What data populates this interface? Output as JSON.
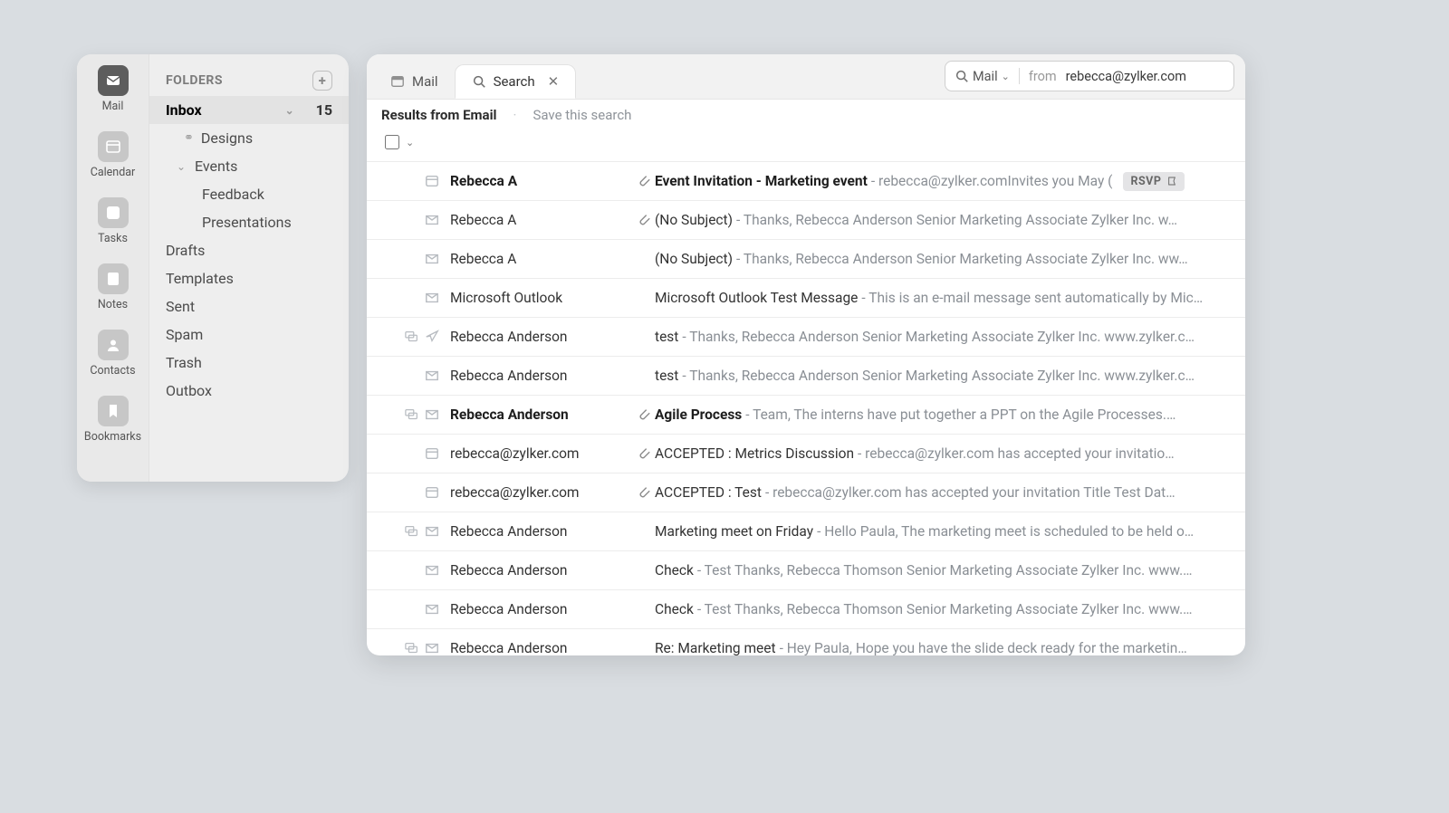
{
  "rail": [
    {
      "label": "Mail",
      "name": "nav-mail",
      "icon": "mail",
      "bg": "#5d5d5d"
    },
    {
      "label": "Calendar",
      "name": "nav-calendar",
      "icon": "calendar",
      "bg": "#c7c7c7"
    },
    {
      "label": "Tasks",
      "name": "nav-tasks",
      "icon": "check",
      "bg": "#c7c7c7"
    },
    {
      "label": "Notes",
      "name": "nav-notes",
      "icon": "note",
      "bg": "#c7c7c7"
    },
    {
      "label": "Contacts",
      "name": "nav-contacts",
      "icon": "user",
      "bg": "#c7c7c7"
    },
    {
      "label": "Bookmarks",
      "name": "nav-bookmarks",
      "icon": "bookmark",
      "bg": "#c7c7c7"
    }
  ],
  "folders": {
    "header": "FOLDERS",
    "inbox": {
      "label": "Inbox",
      "count": "15"
    },
    "designs": "Designs",
    "events": "Events",
    "feedback": "Feedback",
    "presentations": "Presentations",
    "drafts": "Drafts",
    "templates": "Templates",
    "sent": "Sent",
    "spam": "Spam",
    "trash": "Trash",
    "outbox": "Outbox"
  },
  "tabs": {
    "mail": "Mail",
    "search": "Search"
  },
  "search": {
    "scope": "Mail",
    "keyword": "from",
    "value": "rebecca@zylker.com"
  },
  "results": {
    "title": "Results from Email",
    "save": "Save this search"
  },
  "rows": [
    {
      "bold": true,
      "lead": "",
      "kind": "calendar",
      "attach": true,
      "from": "Rebecca A",
      "subject": "Event Invitation - Marketing event",
      "preview": " - rebecca@zylker.comInvites you May (",
      "badge": "RSVP"
    },
    {
      "bold": false,
      "lead": "",
      "kind": "mail",
      "attach": true,
      "from": "Rebecca A",
      "subject": "(No Subject)",
      "preview": " - Thanks, Rebecca Anderson Senior Marketing Associate Zylker Inc. w…"
    },
    {
      "bold": false,
      "lead": "",
      "kind": "mail",
      "attach": false,
      "from": "Rebecca A",
      "subject": "(No Subject)",
      "preview": " - Thanks, Rebecca Anderson Senior Marketing Associate Zylker Inc. ww…"
    },
    {
      "bold": false,
      "lead": "",
      "kind": "mail",
      "attach": false,
      "from": "Microsoft Outlook",
      "subject": "Microsoft Outlook Test Message",
      "preview": " - This is an e-mail message sent automatically by Mic…"
    },
    {
      "bold": false,
      "lead": "thread",
      "kind": "sent",
      "attach": false,
      "from": "Rebecca Anderson",
      "subject": "test",
      "preview": " - Thanks, Rebecca Anderson Senior Marketing Associate Zylker Inc. www.zylker.c…"
    },
    {
      "bold": false,
      "lead": "",
      "kind": "mail",
      "attach": false,
      "from": "Rebecca Anderson",
      "subject": "test",
      "preview": " - Thanks, Rebecca Anderson Senior Marketing Associate Zylker Inc. www.zylker.c…"
    },
    {
      "bold": true,
      "lead": "thread",
      "kind": "mail",
      "attach": true,
      "from": "Rebecca Anderson",
      "subject": "Agile Process",
      "preview": " - Team, The interns have put together a PPT on the Agile Processes.…"
    },
    {
      "bold": false,
      "lead": "",
      "kind": "calendar",
      "attach": true,
      "from": "rebecca@zylker.com",
      "subject": "ACCEPTED : Metrics Discussion",
      "preview": " - rebecca@zylker.com has accepted your invitatio…"
    },
    {
      "bold": false,
      "lead": "",
      "kind": "calendar",
      "attach": true,
      "from": "rebecca@zylker.com",
      "subject": "ACCEPTED : Test",
      "preview": " - rebecca@zylker.com has accepted your invitation Title Test Dat…"
    },
    {
      "bold": false,
      "lead": "thread",
      "kind": "mail",
      "attach": false,
      "from": "Rebecca Anderson",
      "subject": "Marketing meet on Friday",
      "preview": " - Hello Paula, The marketing meet is scheduled to be held o…"
    },
    {
      "bold": false,
      "lead": "",
      "kind": "mail",
      "attach": false,
      "from": "Rebecca Anderson",
      "subject": "Check",
      "preview": " - Test Thanks, Rebecca Thomson Senior Marketing Associate Zylker Inc. www.…"
    },
    {
      "bold": false,
      "lead": "",
      "kind": "mail",
      "attach": false,
      "from": "Rebecca Anderson",
      "subject": "Check",
      "preview": " - Test Thanks, Rebecca Thomson Senior Marketing Associate Zylker Inc. www.…"
    },
    {
      "bold": false,
      "lead": "thread",
      "kind": "mail",
      "attach": false,
      "from": "Rebecca Anderson",
      "subject": "Re: Marketing meet",
      "preview": " - Hey Paula, Hope you have the slide deck ready for the marketin…"
    }
  ]
}
